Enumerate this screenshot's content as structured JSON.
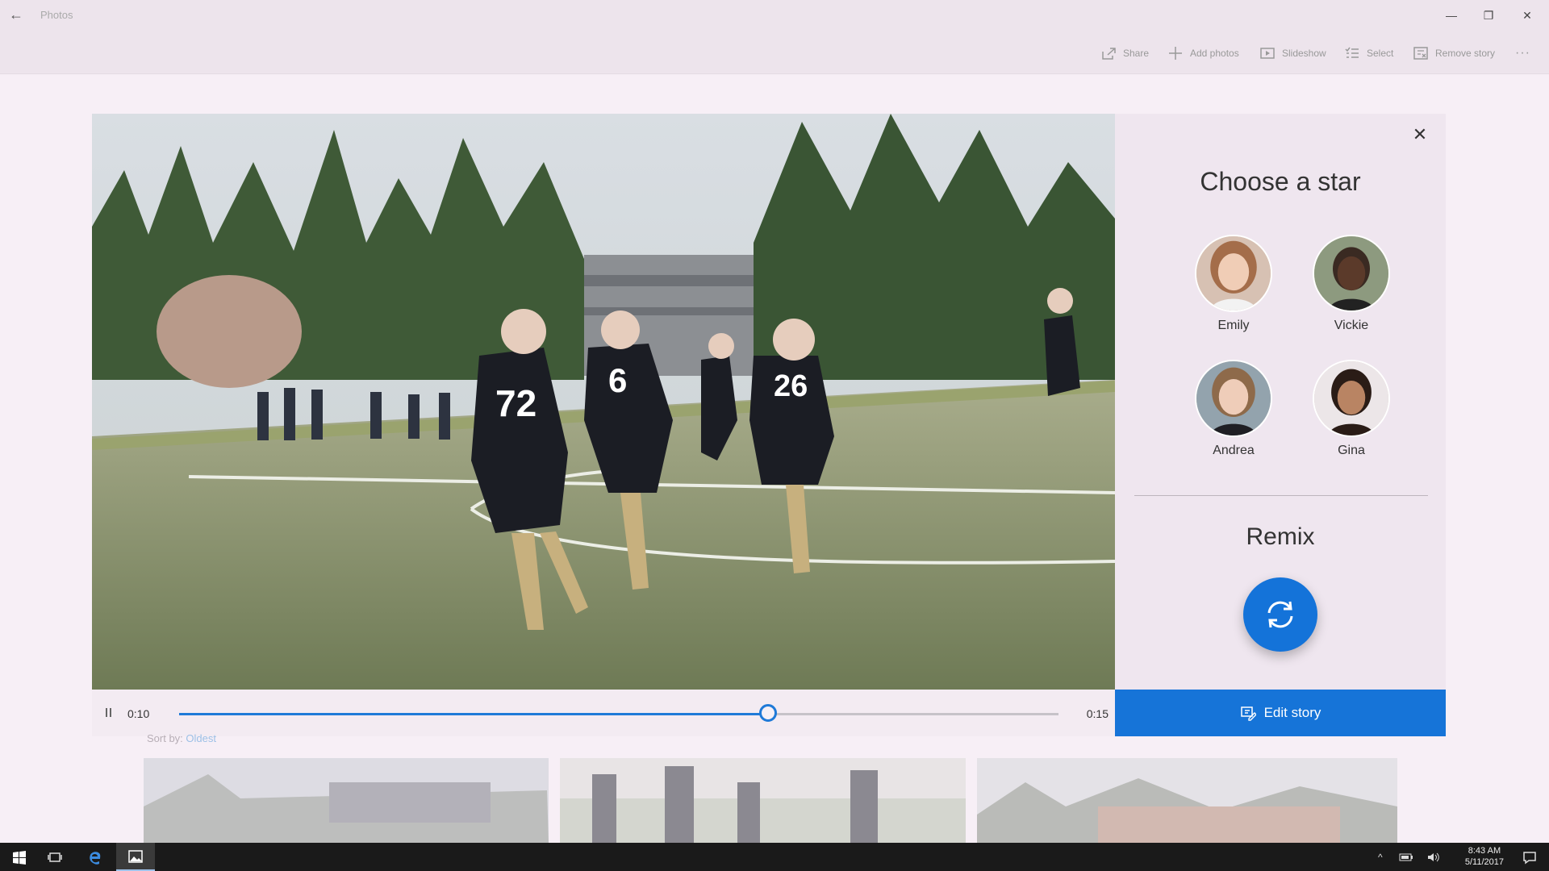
{
  "window": {
    "back_glyph": "←",
    "title": "Photos",
    "minimize_glyph": "—",
    "restore_glyph": "❐",
    "close_glyph": "✕"
  },
  "toolbar": {
    "share": "Share",
    "add_photos": "Add photos",
    "slideshow": "Slideshow",
    "select": "Select",
    "remove_story": "Remove story",
    "more_glyph": "···"
  },
  "player": {
    "current_time": "0:10",
    "end_time": "0:15",
    "progress": 0.67
  },
  "panel": {
    "close_glyph": "✕",
    "title": "Choose a star",
    "people": [
      {
        "name": "Emily"
      },
      {
        "name": "Vickie"
      },
      {
        "name": "Andrea"
      },
      {
        "name": "Gina"
      }
    ],
    "remix_title": "Remix",
    "edit_story": "Edit story"
  },
  "sort": {
    "label": "Sort by:",
    "value": "Oldest"
  },
  "taskbar": {
    "time": "8:43 AM",
    "date": "5/11/2017"
  },
  "colors": {
    "accent": "#1674d8",
    "panel_bg": "#efe6ef",
    "page_bg": "#f7eff6",
    "taskbar_bg": "#1a1a1a"
  }
}
